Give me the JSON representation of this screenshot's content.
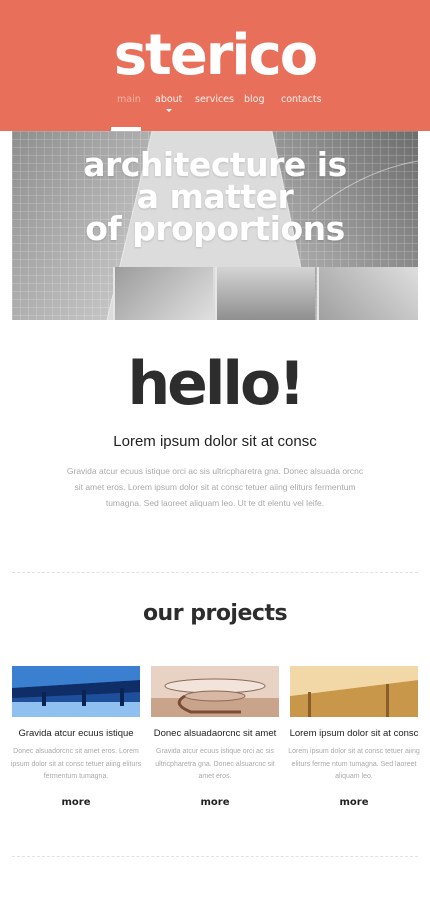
{
  "header": {
    "logo": "sterico",
    "brand_color": "#e8705a",
    "nav": [
      {
        "label": "main",
        "active": true
      },
      {
        "label": "about",
        "has_dropdown": true
      },
      {
        "label": "services"
      },
      {
        "label": "blog"
      },
      {
        "label": "contacts"
      }
    ]
  },
  "hero": {
    "title_lines": [
      "architecture is",
      "a matter",
      "of proportions"
    ]
  },
  "intro": {
    "heading": "hello!",
    "subheading": "Lorem ipsum dolor sit at consc",
    "body": "Gravida atcur ecuus istique orci ac sis ultricpharetra gna. Donec alsuada orcnc sit amet eros. Lorem ipsum dolor sit at consc tetuer aiing eliturs fermentum tumagna. Sed laoreet aliquam leo. Ut te dt elentu vel leife."
  },
  "projects": {
    "heading": "our projects",
    "items": [
      {
        "title": "Gravida atcur ecuus istique",
        "text": "Donec alsuadorcnc sit amet eros. Lorem ipsum dolor sit at consc tetuer aiing eliturs fermentum tumagna.",
        "more": "more"
      },
      {
        "title": "Donec alsuadaorcnc sit amet",
        "text": "Gravida atcur ecuus istique orci ac sis ultricpharetra gna. Donec alsuarcnc sit amet eros.",
        "more": "more"
      },
      {
        "title": "Lorem ipsum dolor sit at consc",
        "text": "Lorem ipsum dolor sit at consc tetuer aiing eliturs ferme ntum tumagna. Sed laoreet aliquam leo.",
        "more": "more"
      }
    ]
  }
}
